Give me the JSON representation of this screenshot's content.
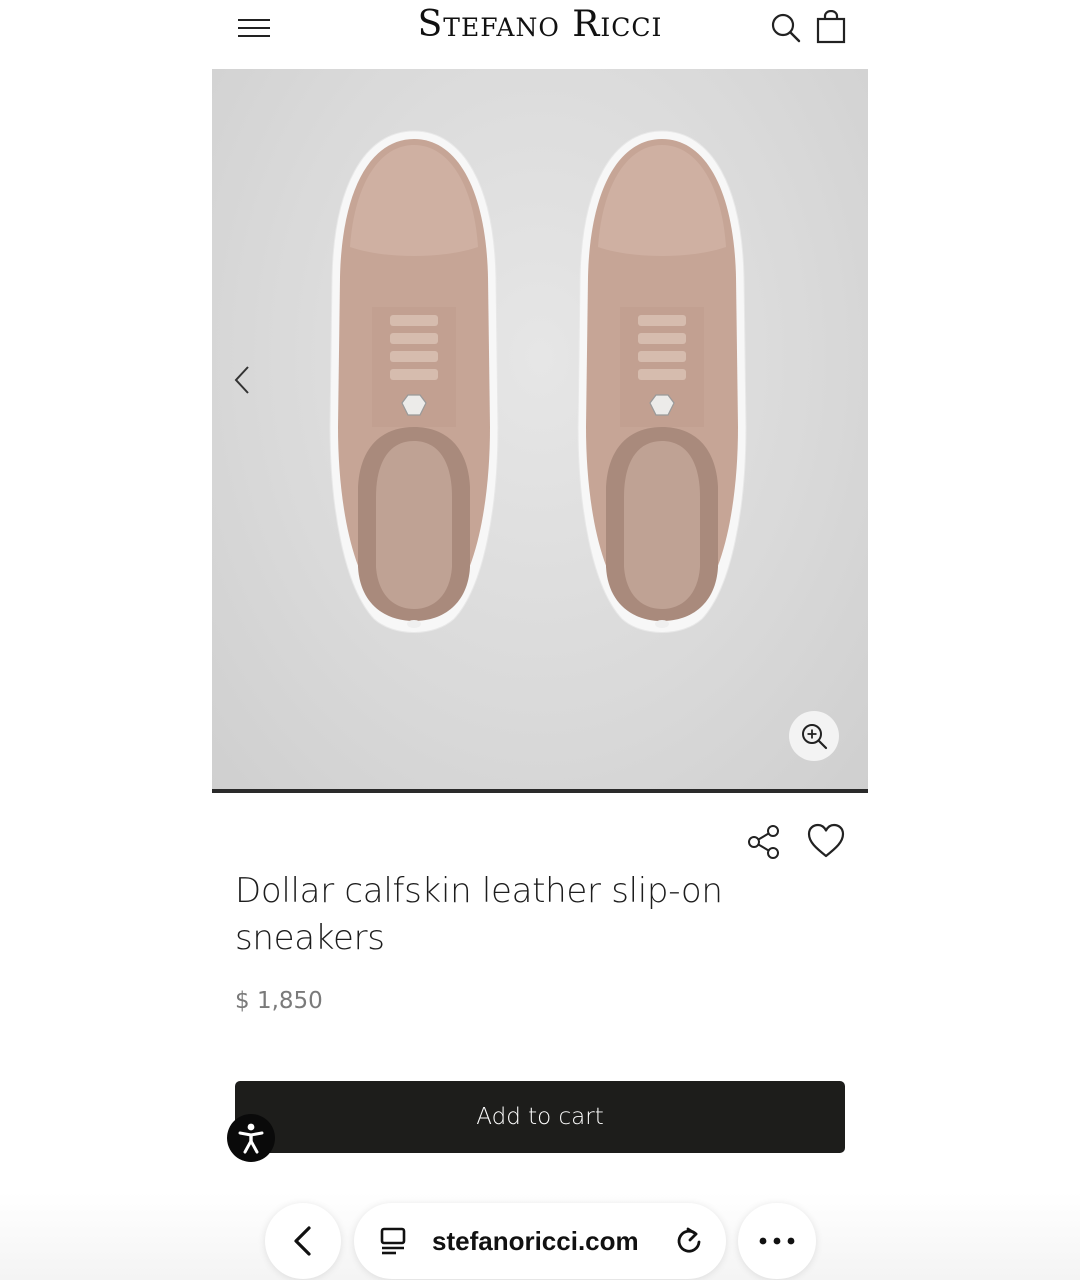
{
  "header": {
    "brand": "Stefano Ricci",
    "menu_icon": "hamburger-menu-icon",
    "search_icon": "search-icon",
    "bag_icon": "shopping-bag-icon"
  },
  "gallery": {
    "prev_icon": "chevron-left-icon",
    "zoom_icon": "zoom-in-icon",
    "image_subject": "pair of slip-on sneakers, top view"
  },
  "product": {
    "title": "Dollar calfskin leather slip-on sneakers",
    "price": "$ 1,850",
    "share_icon": "share-icon",
    "wishlist_icon": "heart-icon",
    "add_to_cart_label": "Add to cart"
  },
  "accessibility": {
    "icon": "accessibility-icon"
  },
  "browser": {
    "url": "stefanoricci.com",
    "back_icon": "chevron-left-icon",
    "tabs_icon": "page-icon",
    "reload_icon": "reload-icon",
    "more_icon": "more-dots-icon"
  },
  "colors": {
    "button_bg": "#1d1d1b",
    "shoe_leather": "#c9aa9c",
    "gallery_bg": "#dcdcdc"
  }
}
